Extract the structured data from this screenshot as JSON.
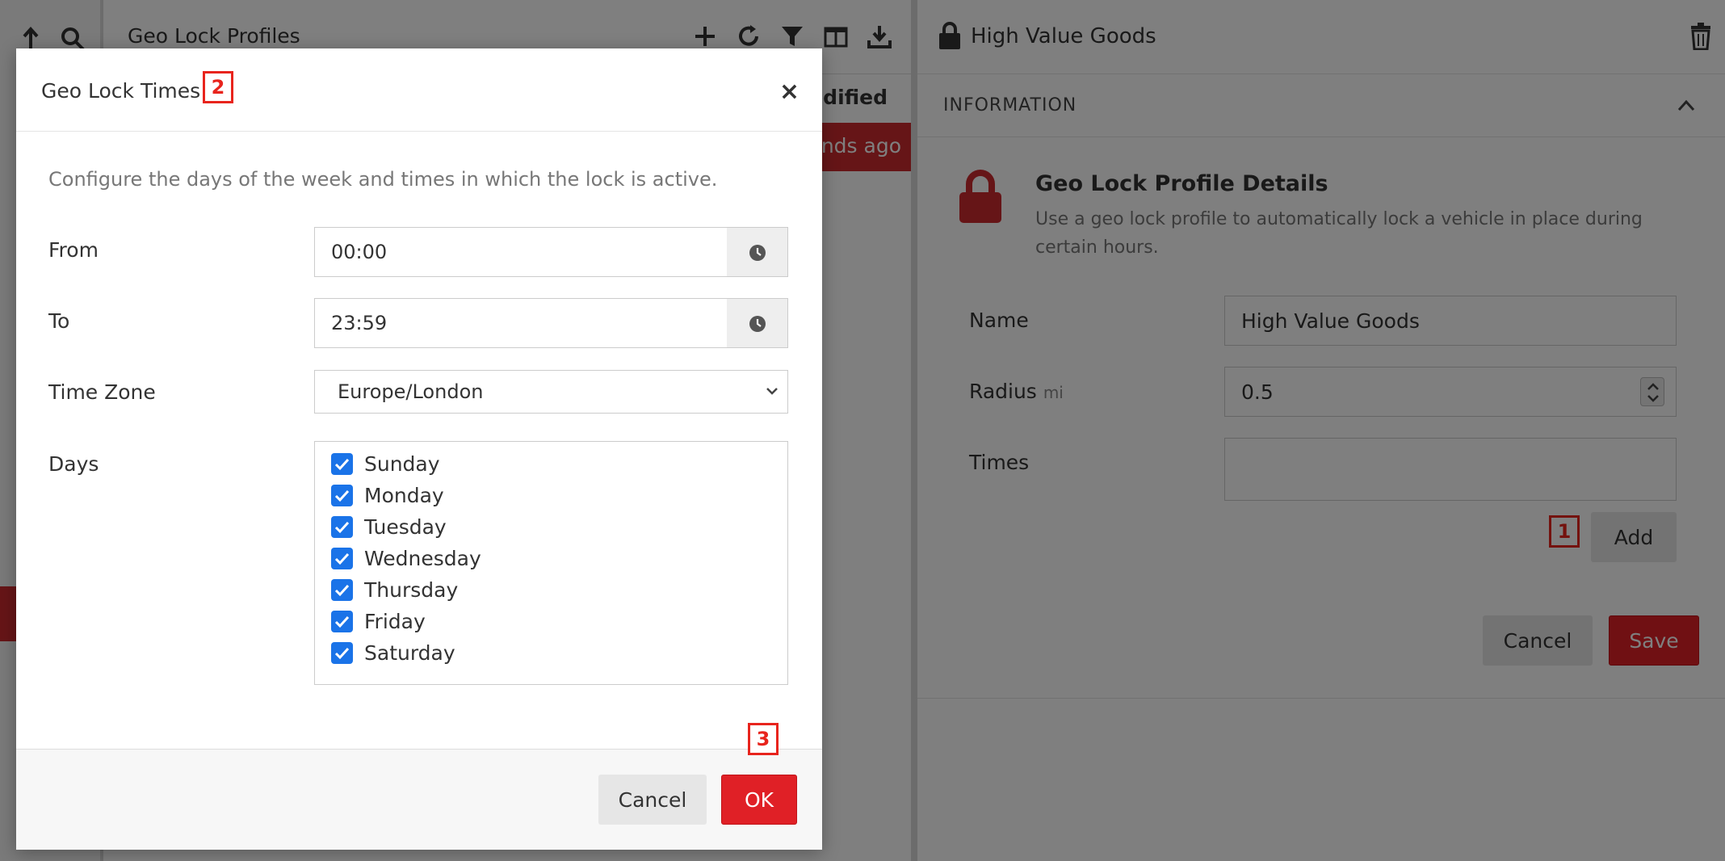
{
  "list": {
    "title": "Geo Lock Profiles",
    "column_modified": "odified",
    "highlighted_row_text": "onds ago"
  },
  "detail": {
    "title": "High Value Goods",
    "section_label": "INFORMATION",
    "heading": "Geo Lock Profile Details",
    "description": "Use a geo lock profile to automatically lock a vehicle in place during certain hours.",
    "name_label": "Name",
    "name_value": "High Value Goods",
    "radius_label": "Radius",
    "radius_unit": "mi",
    "radius_value": "0.5",
    "times_label": "Times",
    "times_value": "",
    "add_label": "Add",
    "cancel_label": "Cancel",
    "save_label": "Save"
  },
  "modal": {
    "title": "Geo Lock Times",
    "close_glyph": "×",
    "description": "Configure the days of the week and times in which the lock is active.",
    "from_label": "From",
    "from_value": "00:00",
    "to_label": "To",
    "to_value": "23:59",
    "timezone_label": "Time Zone",
    "timezone_value": "Europe/London",
    "days_label": "Days",
    "days": [
      {
        "label": "Sunday",
        "checked": true
      },
      {
        "label": "Monday",
        "checked": true
      },
      {
        "label": "Tuesday",
        "checked": true
      },
      {
        "label": "Wednesday",
        "checked": true
      },
      {
        "label": "Thursday",
        "checked": true
      },
      {
        "label": "Friday",
        "checked": true
      },
      {
        "label": "Saturday",
        "checked": true
      }
    ],
    "cancel_label": "Cancel",
    "ok_label": "OK"
  },
  "callouts": {
    "one": "1",
    "two": "2",
    "three": "3"
  },
  "icons": {
    "toolbar": [
      "up-arrow-icon",
      "search-icon",
      "plus-icon",
      "refresh-icon",
      "filter-icon",
      "columns-icon",
      "download-icon"
    ],
    "detail": [
      "lock-icon",
      "trash-icon",
      "chevron-up-icon"
    ],
    "modal": [
      "close-icon",
      "clock-icon",
      "chevron-down-icon",
      "checkbox-icon"
    ]
  },
  "colors": {
    "accent_red": "#e02026",
    "highlight_red": "#cc2a2f",
    "checkbox_blue": "#1a73e8",
    "callout_red": "#e8241d"
  }
}
